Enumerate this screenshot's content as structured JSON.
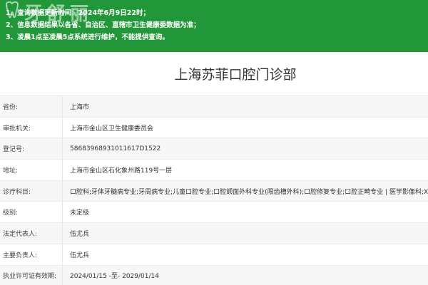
{
  "banner": {
    "logo_text": "牙舒丽",
    "notes": [
      "1、查询数据更新时间：2024年6月9日22时；",
      "2、信息数据结果以各省、自治区、直辖市卫生健康委数据为准；",
      "3、凌晨1点至凌晨5点系统进行维护，不能提供查询。"
    ]
  },
  "title": "上海苏菲口腔门诊部",
  "fields": [
    {
      "label": "省份:",
      "value": "上海市"
    },
    {
      "label": "审批机关:",
      "value": "上海市金山区卫生健康委员会"
    },
    {
      "label": "登记号:",
      "value": "58683968931011617D1522"
    },
    {
      "label": "地址:",
      "value": "上海市金山区石化象州路119号一层"
    },
    {
      "label": "诊疗科目:",
      "value": "口腔科;牙体牙髓病专业;牙周病专业;儿童口腔专业;口腔颌面外科专业(限齿槽外科);口腔修复专业;口腔正畸专业 | 医学影像科;X线诊断专业"
    },
    {
      "label": "级别:",
      "value": "未定级"
    },
    {
      "label": "法定代表人:",
      "value": "伍尤兵"
    },
    {
      "label": "主要负责人:",
      "value": "伍尤兵"
    },
    {
      "label": "执业许可证有效期:",
      "value": "2024/01/15 -至- 2029/01/14"
    }
  ]
}
